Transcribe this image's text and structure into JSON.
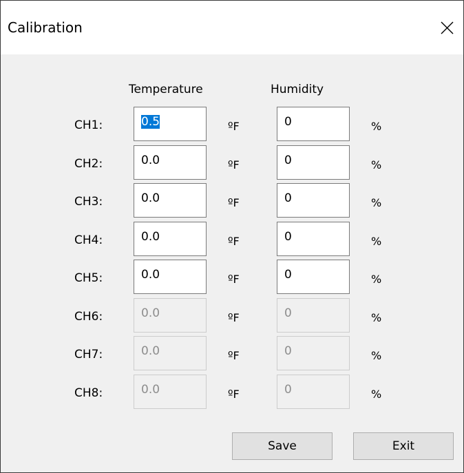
{
  "window": {
    "title": "Calibration",
    "close_glyph": "close-icon"
  },
  "headers": {
    "temperature": "Temperature",
    "humidity": "Humidity"
  },
  "units": {
    "temperature": "ºF",
    "humidity": "%"
  },
  "channels": [
    {
      "label": "CH1:",
      "temperature": "0.5",
      "humidity": "0",
      "enabled": true,
      "selected": true
    },
    {
      "label": "CH2:",
      "temperature": "0.0",
      "humidity": "0",
      "enabled": true
    },
    {
      "label": "CH3:",
      "temperature": "0.0",
      "humidity": "0",
      "enabled": true
    },
    {
      "label": "CH4:",
      "temperature": "0.0",
      "humidity": "0",
      "enabled": true
    },
    {
      "label": "CH5:",
      "temperature": "0.0",
      "humidity": "0",
      "enabled": true
    },
    {
      "label": "CH6:",
      "temperature": "0.0",
      "humidity": "0",
      "enabled": false
    },
    {
      "label": "CH7:",
      "temperature": "0.0",
      "humidity": "0",
      "enabled": false
    },
    {
      "label": "CH8:",
      "temperature": "0.0",
      "humidity": "0",
      "enabled": false
    }
  ],
  "buttons": {
    "save": "Save",
    "exit": "Exit"
  },
  "colors": {
    "selection": "#0078d7",
    "dialog_background": "#f0f0f0",
    "disabled_text": "#8d8d8d"
  }
}
